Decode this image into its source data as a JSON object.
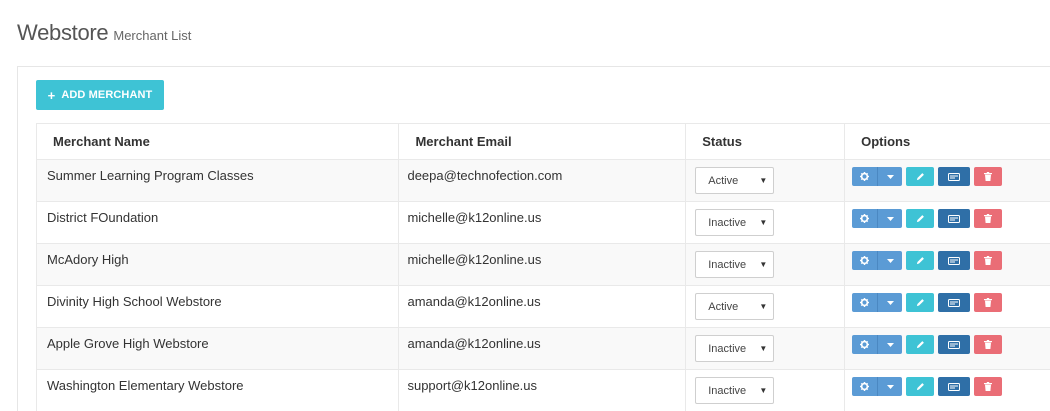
{
  "header": {
    "title": "Webstore",
    "subtitle": "Merchant List"
  },
  "toolbar": {
    "add_label": "ADD MERCHANT",
    "add_icon": "plus-icon"
  },
  "table": {
    "columns": [
      "Merchant Name",
      "Merchant Email",
      "Status",
      "Options"
    ],
    "rows": [
      {
        "name": "Summer Learning Program Classes",
        "email": "deepa@technofection.com",
        "status": "Active"
      },
      {
        "name": "District FOundation",
        "email": "michelle@k12online.us",
        "status": "Inactive"
      },
      {
        "name": "McAdory High",
        "email": "michelle@k12online.us",
        "status": "Inactive"
      },
      {
        "name": "Divinity High School Webstore",
        "email": "amanda@k12online.us",
        "status": "Active"
      },
      {
        "name": "Apple Grove High Webstore",
        "email": "amanda@k12online.us",
        "status": "Inactive"
      },
      {
        "name": "Washington Elementary Webstore",
        "email": "support@k12online.us",
        "status": "Inactive"
      }
    ]
  },
  "option_icons": [
    "gear-icon",
    "caret-down-icon",
    "pencil-icon",
    "card-icon",
    "trash-icon"
  ],
  "colors": {
    "accent": "#3ec3d5",
    "primary": "#5b9bd5",
    "dark_blue": "#2f6fa7",
    "danger": "#ea6d76"
  }
}
